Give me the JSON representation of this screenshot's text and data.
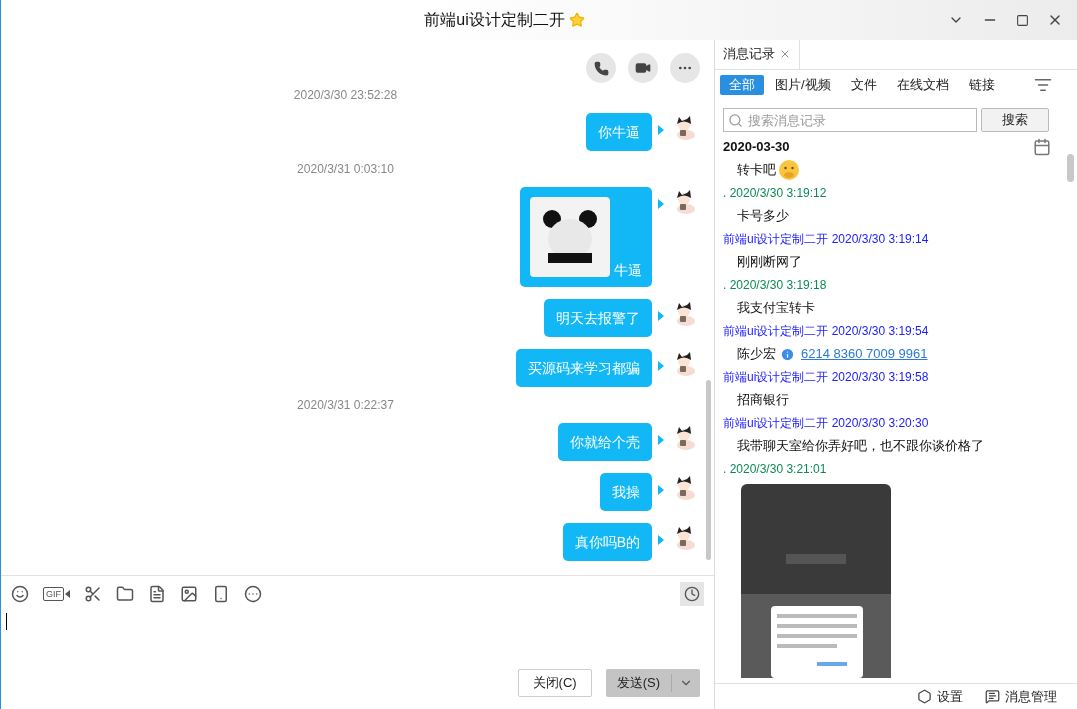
{
  "window": {
    "title": "前端ui设计定制二开",
    "starred": true
  },
  "chat": {
    "messages": [
      {
        "kind": "time",
        "text": "2020/3/30 23:52:28"
      },
      {
        "kind": "bubble",
        "text": "你牛逼"
      },
      {
        "kind": "time",
        "text": "2020/3/31 0:03:10"
      },
      {
        "kind": "sticker",
        "text": "牛逼"
      },
      {
        "kind": "bubble",
        "text": "明天去报警了"
      },
      {
        "kind": "bubble",
        "text": "买源码来学习都骗"
      },
      {
        "kind": "time",
        "text": "2020/3/31 0:22:37"
      },
      {
        "kind": "bubble",
        "text": "你就给个壳"
      },
      {
        "kind": "bubble",
        "text": "我操"
      },
      {
        "kind": "bubble",
        "text": "真你吗B的"
      }
    ],
    "toolbar": [
      {
        "kind": "emoji"
      },
      {
        "kind": "gif",
        "label": "GIF"
      },
      {
        "kind": "scissors"
      },
      {
        "kind": "folder"
      },
      {
        "kind": "doc"
      },
      {
        "kind": "image"
      },
      {
        "kind": "shake"
      },
      {
        "kind": "more"
      }
    ],
    "buttons": {
      "close": "关闭(C)",
      "send": "发送(S)"
    }
  },
  "history": {
    "tab": "消息记录",
    "filters": [
      {
        "label": "全部",
        "selected": true
      },
      {
        "label": "图片/视频",
        "selected": false
      },
      {
        "label": "文件",
        "selected": false
      },
      {
        "label": "在线文档",
        "selected": false
      },
      {
        "label": "链接",
        "selected": false
      }
    ],
    "search": {
      "placeholder": "搜索消息记录",
      "button": "搜索"
    },
    "date": "2020-03-30",
    "items": [
      {
        "kind": "message",
        "text": "转卡吧",
        "emoji": true
      },
      {
        "kind": "meta",
        "text": ". 2020/3/30 3:19:12",
        "color": "#0b8a56"
      },
      {
        "kind": "message",
        "text": "卡号多少",
        "emoji": false
      },
      {
        "kind": "meta",
        "text": "前端ui设计定制二开 2020/3/30 3:19:14",
        "color": "#2020ff"
      },
      {
        "kind": "message",
        "text": "刚刚断网了",
        "emoji": false
      },
      {
        "kind": "meta",
        "text": ". 2020/3/30 3:19:18",
        "color": "#0b8a56"
      },
      {
        "kind": "message",
        "text": "我支付宝转卡",
        "emoji": false
      },
      {
        "kind": "meta",
        "text": "前端ui设计定制二开 2020/3/30 3:19:54",
        "color": "#2020ff"
      },
      {
        "kind": "card",
        "text": "陈少宏",
        "link": "6214 8360 7009 9961"
      },
      {
        "kind": "meta",
        "text": "前端ui设计定制二开 2020/3/30 3:19:58",
        "color": "#2020ff"
      },
      {
        "kind": "message",
        "text": "招商银行",
        "emoji": false
      },
      {
        "kind": "meta",
        "text": "前端ui设计定制二开 2020/3/30 3:20:30",
        "color": "#2020ff"
      },
      {
        "kind": "message",
        "text": "我带聊天室给你弄好吧，也不跟你谈价格了",
        "emoji": false
      },
      {
        "kind": "meta",
        "text": ". 2020/3/30 3:21:01",
        "color": "#0b8a56"
      },
      {
        "kind": "image"
      }
    ],
    "footer": {
      "settings": "设置",
      "manage": "消息管理"
    }
  }
}
